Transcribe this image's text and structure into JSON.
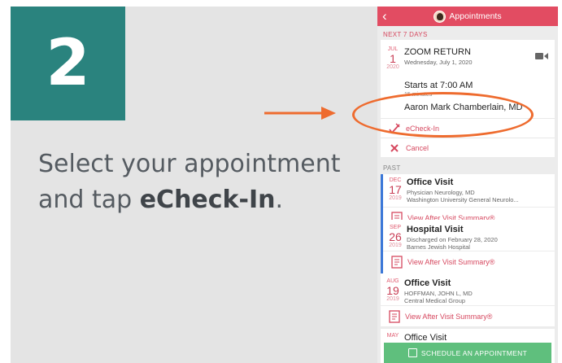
{
  "step": {
    "number": "2"
  },
  "instruction": {
    "text_before": "Select your appointment and tap ",
    "emphasis": "eCheck-In",
    "text_after": "."
  },
  "app": {
    "header": {
      "back_glyph": "‹",
      "title": "Appointments"
    },
    "next_label": "NEXT 7 DAYS",
    "upcoming": {
      "month": "JUL",
      "day": "1",
      "year": "2020",
      "title": "ZOOM RETURN",
      "date_line": "Wednesday, July 1, 2020",
      "starts": "Starts at 7:00 AM",
      "duration": "15 minutes",
      "provider": "Aaron Mark Chamberlain, MD",
      "echeckin_label": "eCheck-In",
      "cancel_label": "Cancel"
    },
    "past_label": "PAST",
    "past": [
      {
        "month": "DEC",
        "day": "17",
        "year": "2019",
        "title": "Office Visit",
        "line1": "Physician Neurology, MD",
        "line2": "Washington University General Neurolo...",
        "summary": "View After Visit Summary®"
      },
      {
        "month": "SEP",
        "day": "26",
        "year": "2019",
        "title": "Hospital Visit",
        "line1": "Discharged on February 28, 2020",
        "line2": "Barnes Jewish Hospital",
        "summary": "View After Visit Summary®"
      },
      {
        "month": "AUG",
        "day": "19",
        "year": "2019",
        "title": "Office Visit",
        "line1": "HOFFMAN, JOHN L, MD",
        "line2": "Central Medical Group",
        "summary": "View After Visit Summary®"
      },
      {
        "month": "MAY",
        "title": "Office Visit"
      }
    ],
    "schedule_button": "SCHEDULE AN APPOINTMENT"
  },
  "colors": {
    "accent": "#e24c62",
    "teal": "#2a837e",
    "highlight": "#ee6b2e",
    "schedule": "#5fbf7d"
  }
}
